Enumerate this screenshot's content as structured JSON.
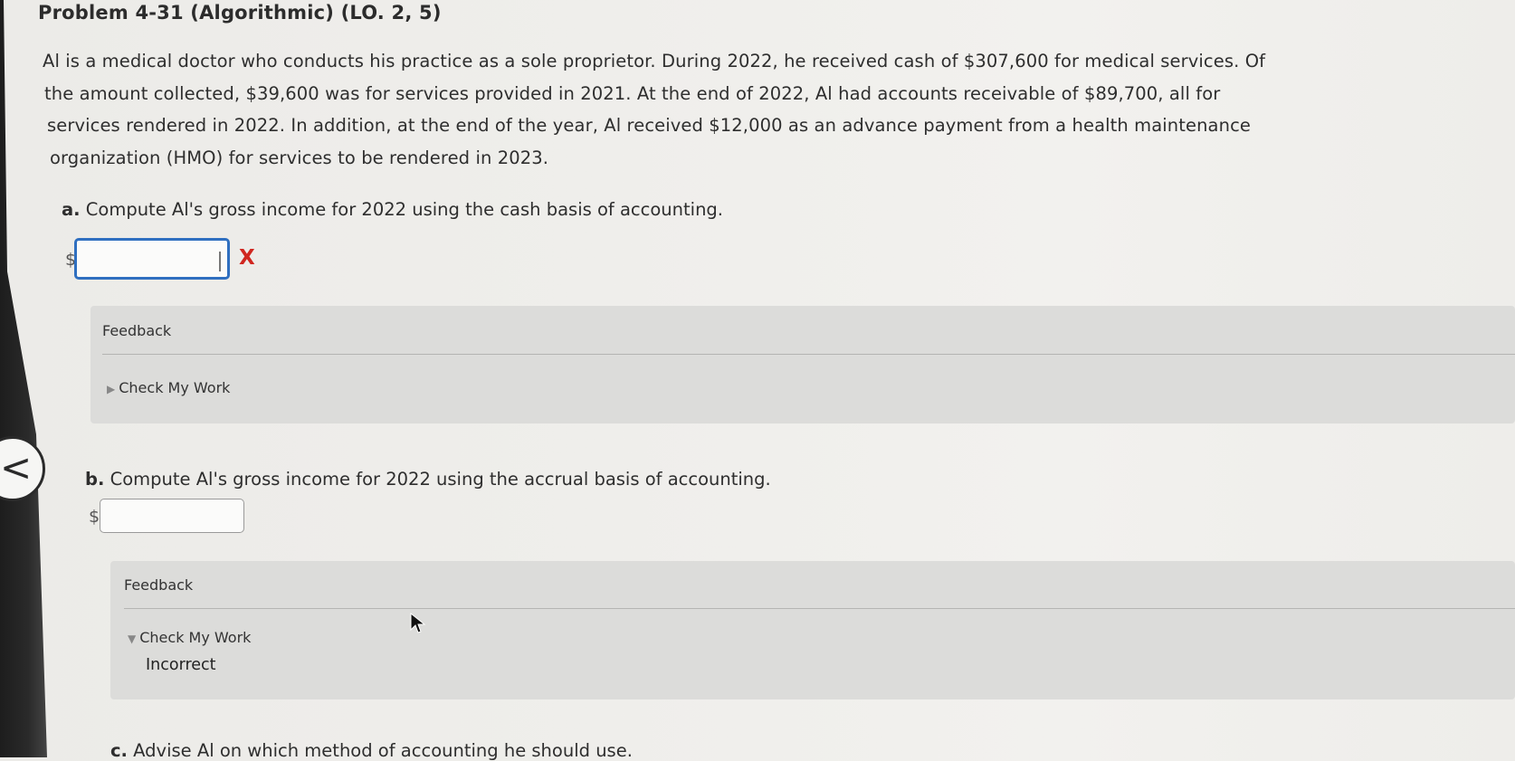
{
  "problem": {
    "title": "Problem 4-31 (Algorithmic) (LO. 2, 5)",
    "paragraph_lines": [
      "Al is a medical doctor who conducts his practice as a sole proprietor. During 2022, he received cash of $307,600 for medical services. Of",
      "the amount collected, $39,600 was for services provided in 2021. At the end of 2022, Al had accounts receivable of $89,700, all for",
      "services rendered in 2022. In addition, at the end of the year, Al received $12,000 as an advance payment from a health maintenance",
      "organization (HMO) for services to be rendered in 2023."
    ]
  },
  "question_a": {
    "letter": "a.",
    "text": "Compute Al's gross income for 2022 using the cash basis of accounting.",
    "currency": "$",
    "value": "",
    "status_mark": "X",
    "feedback": {
      "title": "Feedback",
      "check_label": "Check My Work",
      "expanded": false
    }
  },
  "question_b": {
    "letter": "b.",
    "text": "Compute Al's gross income for 2022 using the accrual basis of accounting.",
    "currency": "$",
    "value": "",
    "feedback": {
      "title": "Feedback",
      "check_label": "Check My Work",
      "expanded": true,
      "result": "Incorrect"
    }
  },
  "question_c": {
    "letter": "c.",
    "text": "Advise Al on which method of accounting he should use."
  },
  "nav": {
    "back_icon": "chevron-left-icon",
    "back_glyph": "<"
  },
  "colors": {
    "input_focus": "#2f6fc0",
    "error": "#d0261f",
    "panel": "#dcdcda"
  }
}
